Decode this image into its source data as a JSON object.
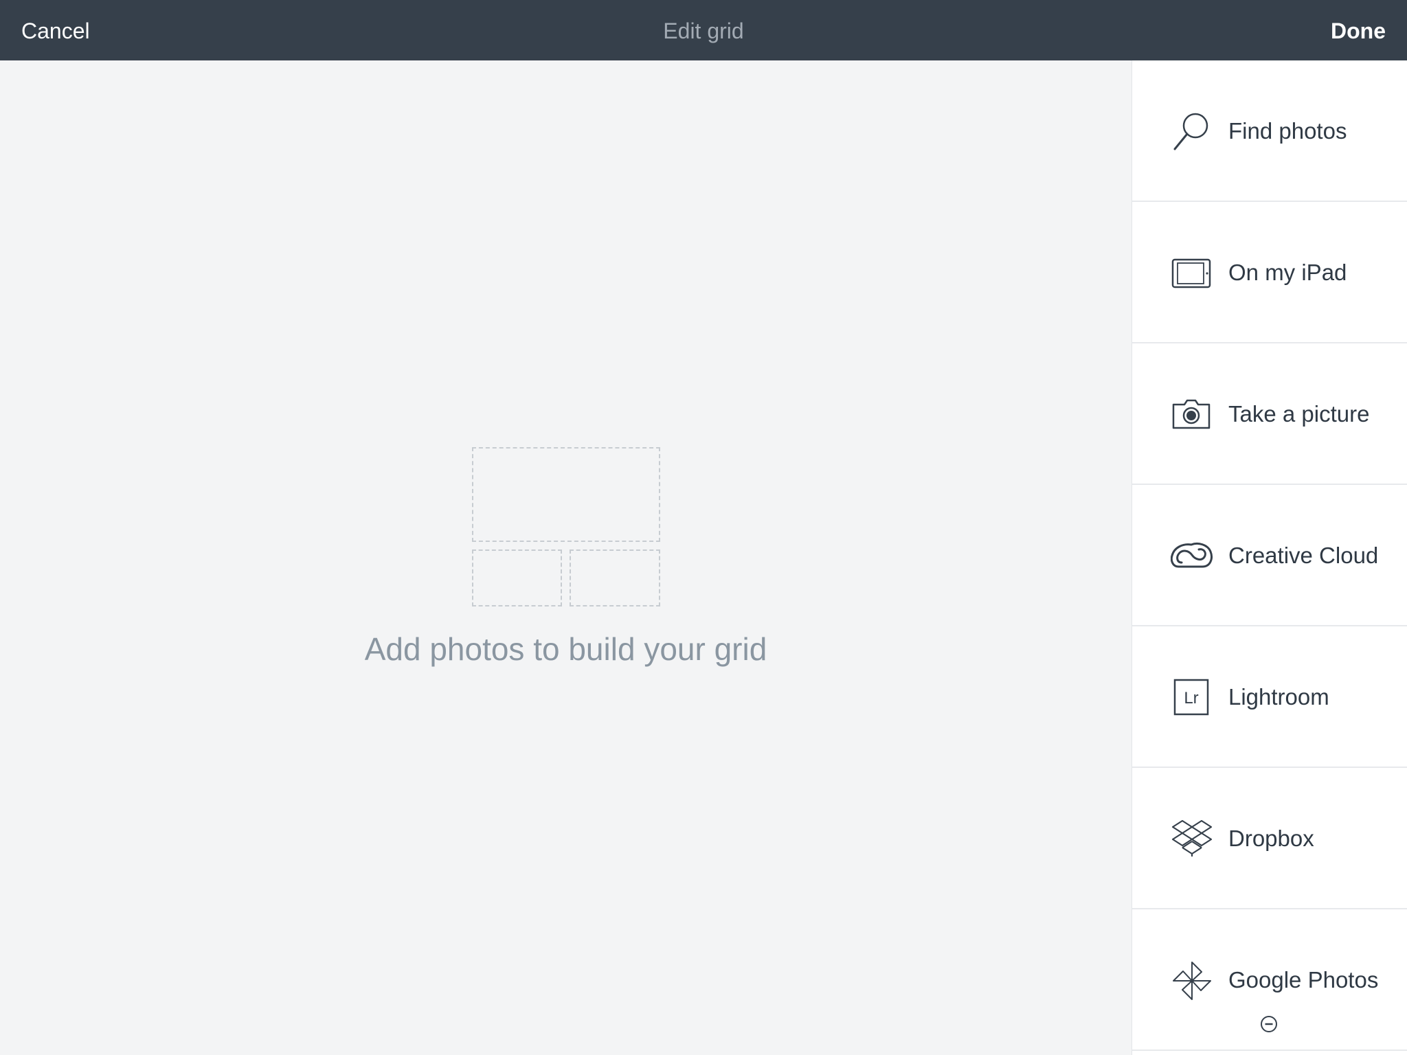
{
  "header": {
    "cancel_label": "Cancel",
    "title": "Edit grid",
    "done_label": "Done"
  },
  "canvas": {
    "hint": "Add photos to build your grid"
  },
  "sidebar": {
    "items": [
      {
        "label": "Find photos",
        "icon": "search-icon"
      },
      {
        "label": "On my iPad",
        "icon": "ipad-icon"
      },
      {
        "label": "Take a picture",
        "icon": "camera-icon"
      },
      {
        "label": "Creative Cloud",
        "icon": "creative-cloud-icon"
      },
      {
        "label": "Lightroom",
        "icon": "lightroom-icon",
        "icon_text": "Lr"
      },
      {
        "label": "Dropbox",
        "icon": "dropbox-icon"
      },
      {
        "label": "Google Photos",
        "icon": "google-photos-icon"
      }
    ]
  },
  "colors": {
    "header_bg": "#36404b",
    "header_title": "#a3abb4",
    "canvas_bg": "#f3f4f5",
    "hint_text": "#8a96a1",
    "sidebar_bg": "#ffffff",
    "item_text": "#2f3944"
  }
}
